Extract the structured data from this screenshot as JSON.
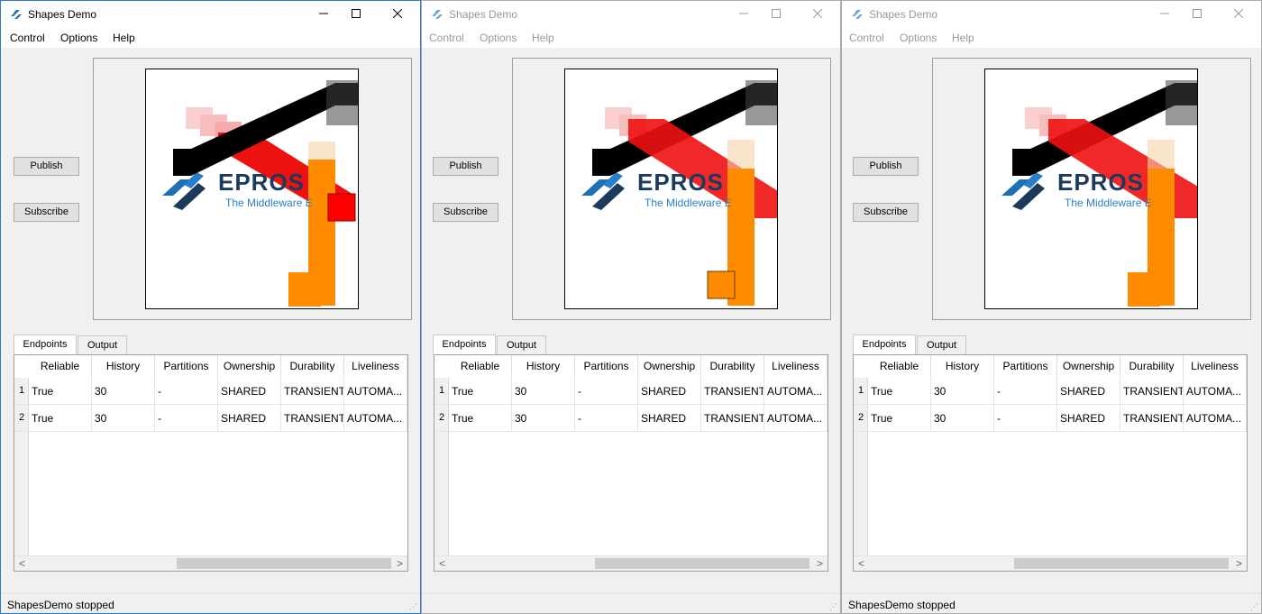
{
  "windows": [
    {
      "title": "Shapes Demo",
      "active": true,
      "menu": [
        "Control",
        "Options",
        "Help"
      ],
      "publish_label": "Publish",
      "subscribe_label": "Subscribe",
      "logo_word": "EPROS",
      "logo_sub": "The Middleware E",
      "tabs": [
        "Endpoints",
        "Output"
      ],
      "columns": [
        "Reliable",
        "History",
        "Partitions",
        "Ownership",
        "Durability",
        "Liveliness"
      ],
      "rows": [
        {
          "num": "1",
          "cells": [
            "True",
            "30",
            "-",
            "SHARED",
            "TRANSIENT",
            "AUTOMA..."
          ]
        },
        {
          "num": "2",
          "cells": [
            "True",
            "30",
            "-",
            "SHARED",
            "TRANSIENT",
            "AUTOMA..."
          ]
        }
      ],
      "scroll_left": "<",
      "scroll_right": ">",
      "status": "ShapesDemo stopped"
    },
    {
      "title": "Shapes Demo",
      "active": false,
      "menu": [
        "Control",
        "Options",
        "Help"
      ],
      "publish_label": "Publish",
      "subscribe_label": "Subscribe",
      "logo_word": "EPROS",
      "logo_sub": "The Middleware E",
      "tabs": [
        "Endpoints",
        "Output"
      ],
      "columns": [
        "Reliable",
        "History",
        "Partitions",
        "Ownership",
        "Durability",
        "Liveliness"
      ],
      "rows": [
        {
          "num": "1",
          "cells": [
            "True",
            "30",
            "-",
            "SHARED",
            "TRANSIENT",
            "AUTOMA..."
          ]
        },
        {
          "num": "2",
          "cells": [
            "True",
            "30",
            "-",
            "SHARED",
            "TRANSIENT",
            "AUTOMA..."
          ]
        }
      ],
      "scroll_left": "<",
      "scroll_right": ">",
      "status": ""
    },
    {
      "title": "Shapes Demo",
      "active": false,
      "menu": [
        "Control",
        "Options",
        "Help"
      ],
      "publish_label": "Publish",
      "subscribe_label": "Subscribe",
      "logo_word": "EPROS",
      "logo_sub": "The Middleware E",
      "tabs": [
        "Endpoints",
        "Output"
      ],
      "columns": [
        "Reliable",
        "History",
        "Partitions",
        "Ownership",
        "Durability",
        "Liveliness"
      ],
      "rows": [
        {
          "num": "1",
          "cells": [
            "True",
            "30",
            "-",
            "SHARED",
            "TRANSIENT",
            "AUTOMA..."
          ]
        },
        {
          "num": "2",
          "cells": [
            "True",
            "30",
            "-",
            "SHARED",
            "TRANSIENT",
            "AUTOMA..."
          ]
        }
      ],
      "scroll_left": "<",
      "scroll_right": ">",
      "status": "ShapesDemo stopped"
    }
  ],
  "colors": {
    "shape_red": "#ff0000",
    "shape_orange": "#ff8c00",
    "shape_black": "#000000",
    "logo_blue": "#1f6fb5",
    "logo_dark": "#1c3b5c"
  }
}
